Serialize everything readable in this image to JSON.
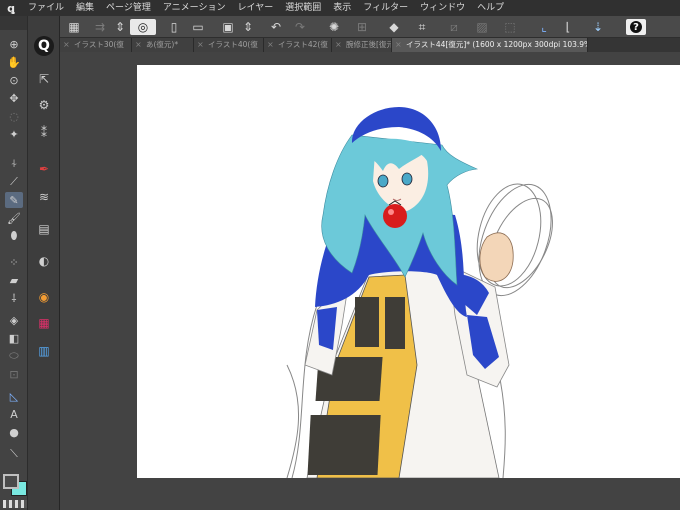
{
  "menu": {
    "logo": "ꝗ",
    "items": [
      "ファイル",
      "編集",
      "ページ管理",
      "アニメーション",
      "レイヤー",
      "選択範囲",
      "表示",
      "フィルター",
      "ウィンドウ",
      "ヘルプ"
    ]
  },
  "command_bar": {
    "icons": [
      "grid-icon",
      "transfer-icon",
      "spinner-icon",
      "swirl-icon",
      "new-file-icon",
      "open-folder-icon",
      "save-icon",
      "spinner-icon",
      "undo-icon",
      "redo-icon",
      "sparkle-icon",
      "transform-icon",
      "fill-icon",
      "crop-icon",
      "clear-icon",
      "hatch-icon",
      "select-icon",
      "ruler-icon",
      "snap-icon",
      "compass-icon",
      "help-icon"
    ],
    "help_label": "?"
  },
  "tabs": [
    {
      "label": "イラスト30(復",
      "active": false
    },
    {
      "label": "あ(復元)*",
      "active": false
    },
    {
      "label": "イラスト40(復",
      "active": false
    },
    {
      "label": "イラスト42(復",
      "active": false
    },
    {
      "label": "腕修正後[復元",
      "active": false
    },
    {
      "label": "イラスト44[復元]* (1600 x 1200px 300dpi 103.9%)",
      "active": true
    }
  ],
  "tab_close_glyph": "×",
  "tools": {
    "main": [
      "zoom-icon",
      "hand-icon",
      "zoom-icon",
      "move-icon",
      "lasso-icon",
      "wand-icon",
      "eyedropper-icon",
      "pen-icon",
      "pencil-icon",
      "brush-icon",
      "airbrush-icon",
      "decorate-icon",
      "eraser-icon",
      "blend-icon",
      "fill-icon",
      "gradient-icon",
      "shape-icon",
      "frame-icon",
      "ruler-icon",
      "text-icon",
      "balloon-icon",
      "line-icon"
    ],
    "sub": [
      "select-layer-icon",
      "settings-icon",
      "operation-icon",
      "pen-icon",
      "texture-icon",
      "layer-icon",
      "layer-icon",
      "color-wheel-icon",
      "color-set-icon",
      "intermediate-icon"
    ]
  },
  "colors": {
    "main_color": "#4a4a4a",
    "sub_color": "#79e8e0",
    "canvas_bg": "#ffffff",
    "hair": "#6cc9d9",
    "cape": "#2b47c9",
    "dress_trim": "#f0c048",
    "dress_panel": "#3f3d37",
    "gem": "#d81c1c"
  }
}
